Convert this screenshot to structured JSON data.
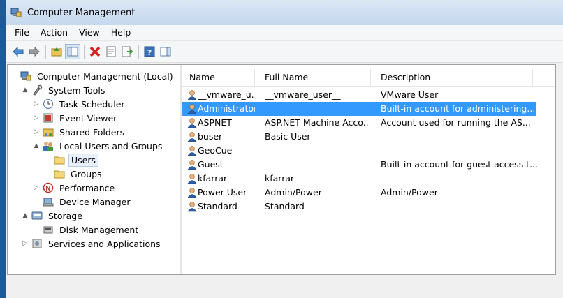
{
  "window": {
    "title": "Computer Management"
  },
  "menu": [
    "File",
    "Action",
    "View",
    "Help"
  ],
  "tree": [
    {
      "label": "Computer Management (Local)",
      "indent": 0,
      "expander": "",
      "icon": "computer-icon"
    },
    {
      "label": "System Tools",
      "indent": 1,
      "expander": "▲",
      "icon": "tools-icon"
    },
    {
      "label": "Task Scheduler",
      "indent": 2,
      "expander": "▷",
      "icon": "clock-icon"
    },
    {
      "label": "Event Viewer",
      "indent": 2,
      "expander": "▷",
      "icon": "event-viewer-icon"
    },
    {
      "label": "Shared Folders",
      "indent": 2,
      "expander": "▷",
      "icon": "shared-folder-icon"
    },
    {
      "label": "Local Users and Groups",
      "indent": 2,
      "expander": "▲",
      "icon": "users-groups-icon"
    },
    {
      "label": "Users",
      "indent": 3,
      "expander": "",
      "icon": "folder-icon",
      "selected": true
    },
    {
      "label": "Groups",
      "indent": 3,
      "expander": "",
      "icon": "folder-icon"
    },
    {
      "label": "Performance",
      "indent": 2,
      "expander": "▷",
      "icon": "performance-icon"
    },
    {
      "label": "Device Manager",
      "indent": 2,
      "expander": "",
      "icon": "device-manager-icon"
    },
    {
      "label": "Storage",
      "indent": 1,
      "expander": "▲",
      "icon": "storage-icon"
    },
    {
      "label": "Disk Management",
      "indent": 2,
      "expander": "",
      "icon": "disk-icon"
    },
    {
      "label": "Services and Applications",
      "indent": 1,
      "expander": "▷",
      "icon": "services-icon"
    }
  ],
  "columns": [
    "Name",
    "Full Name",
    "Description"
  ],
  "users": [
    {
      "name": "__vmware_u...",
      "full_name": "__vmware_user__",
      "description": "VMware User"
    },
    {
      "name": "Administrator",
      "full_name": "",
      "description": "Built-in account for administering...",
      "selected": true
    },
    {
      "name": "ASPNET",
      "full_name": "ASP.NET Machine Acco...",
      "description": "Account used for running the AS..."
    },
    {
      "name": "buser",
      "full_name": "Basic User",
      "description": ""
    },
    {
      "name": "GeoCue",
      "full_name": "",
      "description": ""
    },
    {
      "name": "Guest",
      "full_name": "",
      "description": "Built-in account for guest access t..."
    },
    {
      "name": "kfarrar",
      "full_name": "kfarrar",
      "description": ""
    },
    {
      "name": "Power User",
      "full_name": "Admin/Power",
      "description": "Admin/Power"
    },
    {
      "name": "Standard",
      "full_name": "Standard",
      "description": ""
    }
  ],
  "colors": {
    "selection": "#3399ff",
    "border_accent": "#1f5a96"
  }
}
